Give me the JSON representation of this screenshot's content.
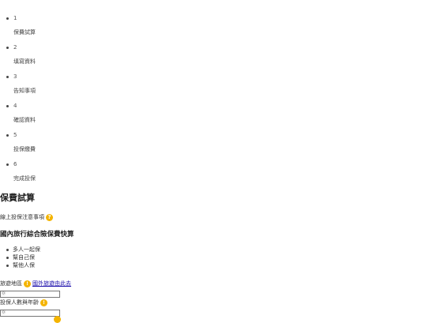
{
  "steps": [
    {
      "num": "1",
      "label": "保費試算"
    },
    {
      "num": "2",
      "label": "填寫資料"
    },
    {
      "num": "3",
      "label": "告知事項"
    },
    {
      "num": "4",
      "label": "確認資料"
    },
    {
      "num": "5",
      "label": "投保繳費"
    },
    {
      "num": "6",
      "label": "完成投保"
    }
  ],
  "page_title": "保費試算",
  "notice": {
    "label": "線上投保注意事項",
    "icon": "question-icon",
    "glyph": "?"
  },
  "subtitle": "國內旅行綜合險保費快算",
  "options": [
    "多人一起保",
    "幫自己保",
    "幫他人保"
  ],
  "destination": {
    "label": "旅遊地區",
    "info_glyph": "!",
    "link_text": "國外旅遊由此去",
    "input_value": "Ⓓ"
  },
  "insured": {
    "label": "投保人數與年齡",
    "info_glyph": "!",
    "input_value": "Ⓓ"
  },
  "colors": {
    "accent": "#f4b400",
    "link": "#1a0dab"
  }
}
